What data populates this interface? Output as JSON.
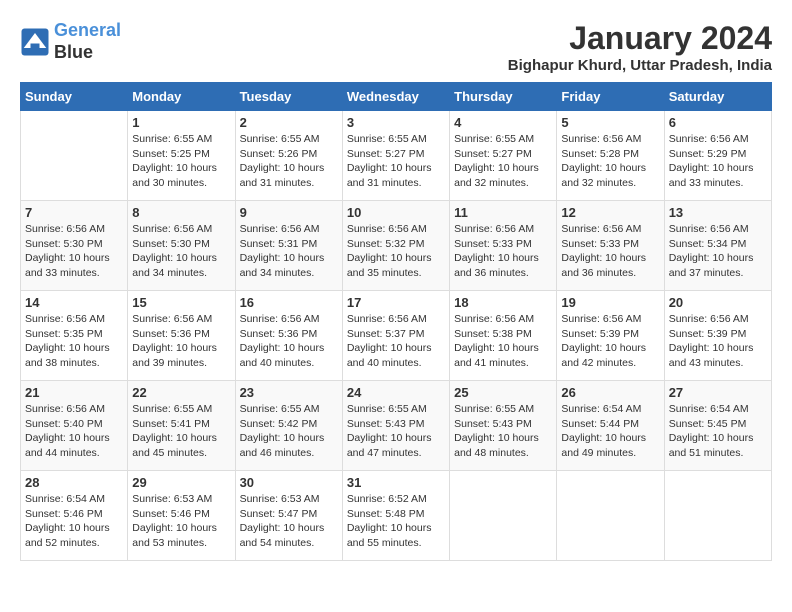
{
  "logo": {
    "line1": "General",
    "line2": "Blue"
  },
  "title": "January 2024",
  "subtitle": "Bighapur Khurd, Uttar Pradesh, India",
  "days_header": [
    "Sunday",
    "Monday",
    "Tuesday",
    "Wednesday",
    "Thursday",
    "Friday",
    "Saturday"
  ],
  "weeks": [
    [
      {
        "day": "",
        "info": ""
      },
      {
        "day": "1",
        "info": "Sunrise: 6:55 AM\nSunset: 5:25 PM\nDaylight: 10 hours\nand 30 minutes."
      },
      {
        "day": "2",
        "info": "Sunrise: 6:55 AM\nSunset: 5:26 PM\nDaylight: 10 hours\nand 31 minutes."
      },
      {
        "day": "3",
        "info": "Sunrise: 6:55 AM\nSunset: 5:27 PM\nDaylight: 10 hours\nand 31 minutes."
      },
      {
        "day": "4",
        "info": "Sunrise: 6:55 AM\nSunset: 5:27 PM\nDaylight: 10 hours\nand 32 minutes."
      },
      {
        "day": "5",
        "info": "Sunrise: 6:56 AM\nSunset: 5:28 PM\nDaylight: 10 hours\nand 32 minutes."
      },
      {
        "day": "6",
        "info": "Sunrise: 6:56 AM\nSunset: 5:29 PM\nDaylight: 10 hours\nand 33 minutes."
      }
    ],
    [
      {
        "day": "7",
        "info": "Sunrise: 6:56 AM\nSunset: 5:30 PM\nDaylight: 10 hours\nand 33 minutes."
      },
      {
        "day": "8",
        "info": "Sunrise: 6:56 AM\nSunset: 5:30 PM\nDaylight: 10 hours\nand 34 minutes."
      },
      {
        "day": "9",
        "info": "Sunrise: 6:56 AM\nSunset: 5:31 PM\nDaylight: 10 hours\nand 34 minutes."
      },
      {
        "day": "10",
        "info": "Sunrise: 6:56 AM\nSunset: 5:32 PM\nDaylight: 10 hours\nand 35 minutes."
      },
      {
        "day": "11",
        "info": "Sunrise: 6:56 AM\nSunset: 5:33 PM\nDaylight: 10 hours\nand 36 minutes."
      },
      {
        "day": "12",
        "info": "Sunrise: 6:56 AM\nSunset: 5:33 PM\nDaylight: 10 hours\nand 36 minutes."
      },
      {
        "day": "13",
        "info": "Sunrise: 6:56 AM\nSunset: 5:34 PM\nDaylight: 10 hours\nand 37 minutes."
      }
    ],
    [
      {
        "day": "14",
        "info": "Sunrise: 6:56 AM\nSunset: 5:35 PM\nDaylight: 10 hours\nand 38 minutes."
      },
      {
        "day": "15",
        "info": "Sunrise: 6:56 AM\nSunset: 5:36 PM\nDaylight: 10 hours\nand 39 minutes."
      },
      {
        "day": "16",
        "info": "Sunrise: 6:56 AM\nSunset: 5:36 PM\nDaylight: 10 hours\nand 40 minutes."
      },
      {
        "day": "17",
        "info": "Sunrise: 6:56 AM\nSunset: 5:37 PM\nDaylight: 10 hours\nand 40 minutes."
      },
      {
        "day": "18",
        "info": "Sunrise: 6:56 AM\nSunset: 5:38 PM\nDaylight: 10 hours\nand 41 minutes."
      },
      {
        "day": "19",
        "info": "Sunrise: 6:56 AM\nSunset: 5:39 PM\nDaylight: 10 hours\nand 42 minutes."
      },
      {
        "day": "20",
        "info": "Sunrise: 6:56 AM\nSunset: 5:39 PM\nDaylight: 10 hours\nand 43 minutes."
      }
    ],
    [
      {
        "day": "21",
        "info": "Sunrise: 6:56 AM\nSunset: 5:40 PM\nDaylight: 10 hours\nand 44 minutes."
      },
      {
        "day": "22",
        "info": "Sunrise: 6:55 AM\nSunset: 5:41 PM\nDaylight: 10 hours\nand 45 minutes."
      },
      {
        "day": "23",
        "info": "Sunrise: 6:55 AM\nSunset: 5:42 PM\nDaylight: 10 hours\nand 46 minutes."
      },
      {
        "day": "24",
        "info": "Sunrise: 6:55 AM\nSunset: 5:43 PM\nDaylight: 10 hours\nand 47 minutes."
      },
      {
        "day": "25",
        "info": "Sunrise: 6:55 AM\nSunset: 5:43 PM\nDaylight: 10 hours\nand 48 minutes."
      },
      {
        "day": "26",
        "info": "Sunrise: 6:54 AM\nSunset: 5:44 PM\nDaylight: 10 hours\nand 49 minutes."
      },
      {
        "day": "27",
        "info": "Sunrise: 6:54 AM\nSunset: 5:45 PM\nDaylight: 10 hours\nand 51 minutes."
      }
    ],
    [
      {
        "day": "28",
        "info": "Sunrise: 6:54 AM\nSunset: 5:46 PM\nDaylight: 10 hours\nand 52 minutes."
      },
      {
        "day": "29",
        "info": "Sunrise: 6:53 AM\nSunset: 5:46 PM\nDaylight: 10 hours\nand 53 minutes."
      },
      {
        "day": "30",
        "info": "Sunrise: 6:53 AM\nSunset: 5:47 PM\nDaylight: 10 hours\nand 54 minutes."
      },
      {
        "day": "31",
        "info": "Sunrise: 6:52 AM\nSunset: 5:48 PM\nDaylight: 10 hours\nand 55 minutes."
      },
      {
        "day": "",
        "info": ""
      },
      {
        "day": "",
        "info": ""
      },
      {
        "day": "",
        "info": ""
      }
    ]
  ]
}
